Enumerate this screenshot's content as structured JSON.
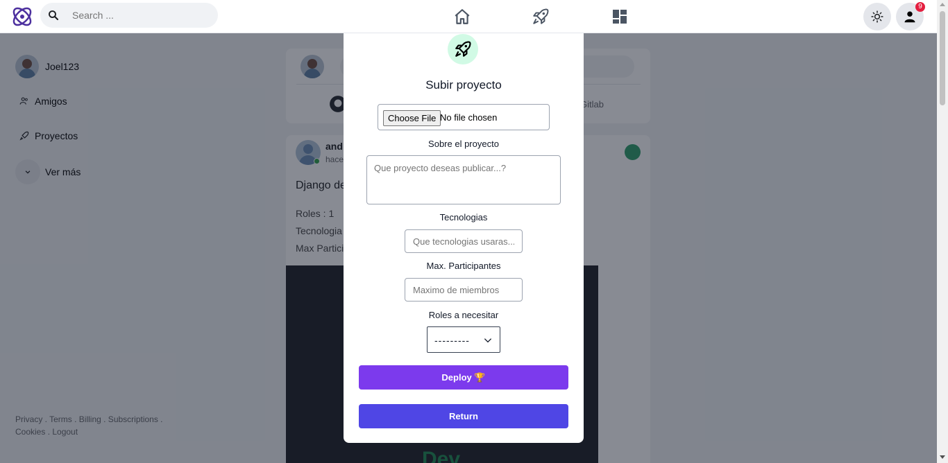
{
  "topbar": {
    "search_placeholder": "Search ...",
    "notification_count": "9"
  },
  "sidebar": {
    "user_name": "Joel123",
    "items": [
      {
        "label": "Amigos",
        "icon": "friends-icon"
      },
      {
        "label": "Proyectos",
        "icon": "rocket-icon"
      },
      {
        "label": "Ver más",
        "icon": "chevron-down-icon"
      }
    ],
    "footer_line1": "Privacy . Terms . Billing . Subscriptions .",
    "footer_line2": "Cookies . Logout"
  },
  "feed": {
    "composer_link": "Gitlab",
    "post": {
      "author_partial": "and",
      "time_partial": "hace",
      "title_partial": "Django de",
      "roles_partial": "Roles : 1",
      "tech_partial": "Tecnologia",
      "max_partial": "Max Partici",
      "image_text": "Dev"
    }
  },
  "modal": {
    "title": "Subir proyecto",
    "file_button": "Choose File",
    "file_status": "No file chosen",
    "about_label": "Sobre el proyecto",
    "about_placeholder": "Que proyecto deseas publicar...?",
    "tech_label": "Tecnologias",
    "tech_placeholder": "Que tecnologias usaras...?",
    "max_label": "Max. Participantes",
    "max_placeholder": "Maximo de miembros",
    "roles_label": "Roles a necesitar",
    "roles_value": "---------",
    "deploy_label": "Deploy 🏆",
    "return_label": "Return"
  },
  "colors": {
    "deploy": "#7c3aed",
    "return": "#4f46e5",
    "accent_green": "#d1fae5"
  }
}
